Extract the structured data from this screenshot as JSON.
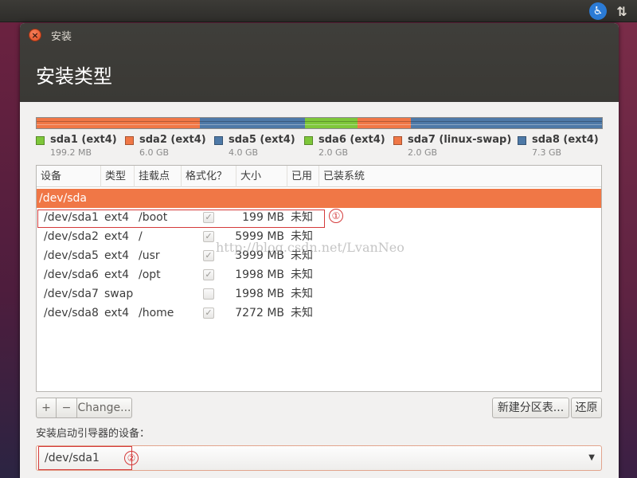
{
  "window": {
    "title": "安装",
    "heading": "安装类型"
  },
  "panel": {
    "accessibility_icon": "accessibility-icon",
    "network_icon": "network-updown-icon"
  },
  "partition_bar": {
    "segments": [
      {
        "name": "sda1",
        "color": "#f07746",
        "weight": 1
      },
      {
        "name": "sda2",
        "color": "#f07746",
        "weight": 205
      },
      {
        "name": "sda5",
        "color": "#4e79a7",
        "weight": 132
      },
      {
        "name": "sda6",
        "color": "#7ec73a",
        "weight": 66
      },
      {
        "name": "sda7",
        "color": "#f07746",
        "weight": 67
      },
      {
        "name": "sda8",
        "color": "#4e79a7",
        "weight": 241
      }
    ]
  },
  "legend": [
    {
      "name": "sda1 (ext4)",
      "size": "199.2 MB",
      "color": "#7ec73a"
    },
    {
      "name": "sda2 (ext4)",
      "size": "6.0 GB",
      "color": "#f07746"
    },
    {
      "name": "sda5 (ext4)",
      "size": "4.0 GB",
      "color": "#4e79a7"
    },
    {
      "name": "sda6 (ext4)",
      "size": "2.0 GB",
      "color": "#7ec73a"
    },
    {
      "name": "sda7 (linux-swap)",
      "size": "2.0 GB",
      "color": "#f07746"
    },
    {
      "name": "sda8 (ext4)",
      "size": "7.3 GB",
      "color": "#4e79a7"
    }
  ],
  "table": {
    "headers": [
      "设备",
      "类型",
      "挂载点",
      "格式化？",
      "大小",
      "已用",
      "已装系统"
    ],
    "device_row": "/dev/sda",
    "rows": [
      {
        "device": "/dev/sda1",
        "type": "ext4",
        "mount": "/boot",
        "format": true,
        "size": "199 MB",
        "used": "未知"
      },
      {
        "device": "/dev/sda2",
        "type": "ext4",
        "mount": "/",
        "format": true,
        "size": "5999 MB",
        "used": "未知"
      },
      {
        "device": "/dev/sda5",
        "type": "ext4",
        "mount": "/usr",
        "format": true,
        "size": "3999 MB",
        "used": "未知"
      },
      {
        "device": "/dev/sda6",
        "type": "ext4",
        "mount": "/opt",
        "format": true,
        "size": "1998 MB",
        "used": "未知"
      },
      {
        "device": "/dev/sda7",
        "type": "swap",
        "mount": "",
        "format": false,
        "size": "1998 MB",
        "used": "未知"
      },
      {
        "device": "/dev/sda8",
        "type": "ext4",
        "mount": "/home",
        "format": true,
        "size": "7272 MB",
        "used": "未知"
      }
    ]
  },
  "annotations": {
    "mark1": "①",
    "mark2": "②",
    "watermark": "http://blog.csdn.net/LvanNeo"
  },
  "buttons": {
    "add": "+",
    "remove": "−",
    "change": "Change...",
    "new_table": "新建分区表...",
    "revert": "还原"
  },
  "bootloader": {
    "label": "安装启动引导器的设备：",
    "value": "/dev/sda1"
  }
}
